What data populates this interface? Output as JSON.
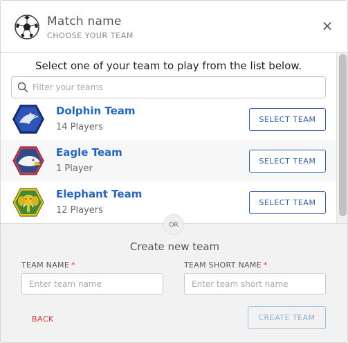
{
  "header": {
    "title": "Match name",
    "subtitle": "CHOOSE YOUR TEAM",
    "close_glyph": "×"
  },
  "list": {
    "instruction": "Select one of your team to play from the list below.",
    "filter_placeholder": "Filter your teams",
    "teams": [
      {
        "name": "Dolphin Team",
        "players": "14 Players",
        "button": "SELECT TEAM",
        "logo_icon": "dolphin-logo-icon",
        "logo_color": "#1c3b8c"
      },
      {
        "name": "Eagle Team",
        "players": "1 Player",
        "button": "SELECT TEAM",
        "logo_icon": "eagle-logo-icon",
        "logo_color": "#d33a4a"
      },
      {
        "name": "Elephant Team",
        "players": "12 Players",
        "button": "SELECT TEAM",
        "logo_icon": "elephant-logo-icon",
        "logo_color": "#e6c21c"
      }
    ]
  },
  "divider": {
    "label": "OR"
  },
  "create": {
    "title": "Create new team",
    "team_name_label": "TEAM NAME",
    "team_name_placeholder": "Enter team name",
    "team_short_label": "TEAM SHORT NAME",
    "team_short_placeholder": "Enter team short name",
    "required_mark": "*",
    "back_label": "BACK",
    "create_label": "CREATE TEAM"
  },
  "colors": {
    "accent": "#2466c7",
    "required": "#dd3333",
    "button_border": "#2a5ea8"
  }
}
